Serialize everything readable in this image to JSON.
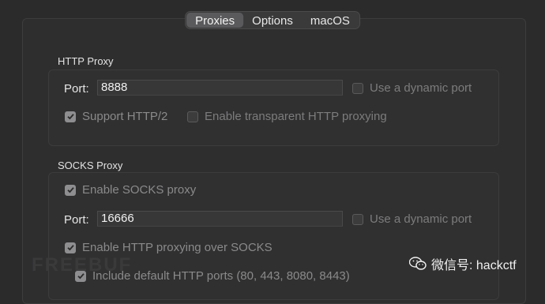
{
  "tabs": [
    "Proxies",
    "Options",
    "macOS"
  ],
  "http_proxy": {
    "title": "HTTP Proxy",
    "port_label": "Port:",
    "port_value": "8888",
    "dynamic_port_label": "Use a dynamic port",
    "dynamic_port_checked": false,
    "http2_label": "Support HTTP/2",
    "http2_checked": true,
    "transparent_label": "Enable transparent HTTP proxying",
    "transparent_checked": false
  },
  "socks_proxy": {
    "title": "SOCKS Proxy",
    "enable_label": "Enable SOCKS proxy",
    "enable_checked": true,
    "port_label": "Port:",
    "port_value": "16666",
    "dynamic_port_label": "Use a dynamic port",
    "dynamic_port_checked": false,
    "http_over_socks_label": "Enable HTTP proxying over SOCKS",
    "http_over_socks_checked": true,
    "default_ports_label": "Include default HTTP ports (80, 443, 8080, 8443)",
    "default_ports_checked": true
  },
  "watermark": {
    "left_text": "FREEBUF",
    "right_text": "微信号: hackctf"
  }
}
